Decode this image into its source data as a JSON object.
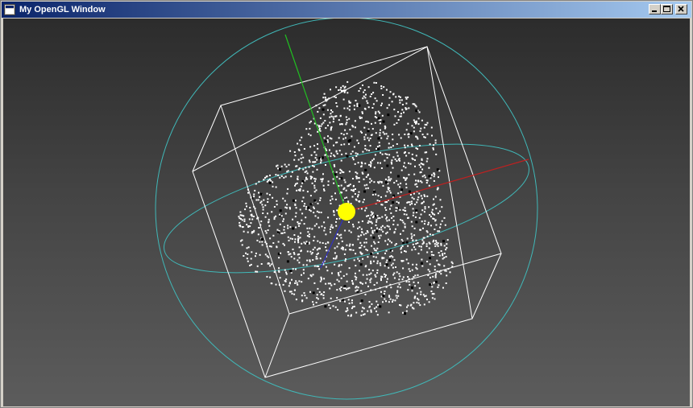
{
  "window": {
    "title": "My OpenGL Window",
    "controls": [
      "minimize",
      "maximize",
      "close"
    ]
  },
  "scene": {
    "background_top": "#2c2c2c",
    "background_bottom": "#5c5c5c",
    "bounding_box_color": "#ffffff",
    "trackball_color": "#40b8b8",
    "axis_colors": {
      "x": "#c02020",
      "y": "#20c020",
      "z": "#3030c0"
    },
    "pivot_color": "#ffff00",
    "point_color": "#ffffff",
    "dark_point_color": "#000000"
  }
}
